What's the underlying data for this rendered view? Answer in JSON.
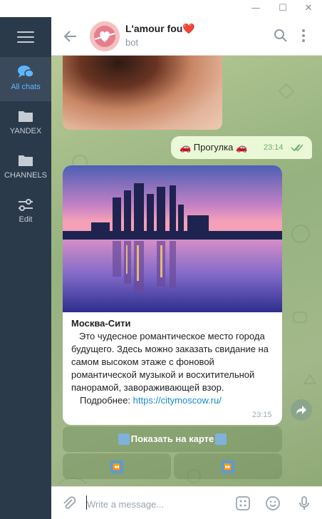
{
  "sidebar": {
    "items": [
      {
        "label": "All chats",
        "icon": "chat-bubbles-icon",
        "active": true
      },
      {
        "label": "YANDEX",
        "icon": "folder-icon",
        "active": false
      },
      {
        "label": "CHANNELS",
        "icon": "folder-icon",
        "active": false
      },
      {
        "label": "Edit",
        "icon": "sliders-icon",
        "active": false
      }
    ]
  },
  "header": {
    "title": "L'amour fou❤️",
    "subtitle": "bot"
  },
  "messages": {
    "outgoing": {
      "text": "🚗 Прогулка 🚗",
      "time": "23:14"
    },
    "incoming": {
      "name": "Москва-Сити",
      "text": "   Это чудесное романтическое место города будущего. Здесь можно заказать свидание на самом высоком этаже с фоновой романтической музыкой и восхитительной панорамой, завораживающей взор.",
      "more_label": "Подробнее:",
      "link": "https://citymoscow.ru/",
      "time": "23:15"
    }
  },
  "keyboard": {
    "map_button": "Показать на карте",
    "prev_button": "⏪",
    "next_button": "⏩"
  },
  "composer": {
    "placeholder": "Write a message..."
  },
  "colors": {
    "sidebar_bg": "#2b3a4a",
    "accent": "#5db7ff",
    "outgoing_bubble": "#eaf8d8",
    "link": "#168acd"
  }
}
